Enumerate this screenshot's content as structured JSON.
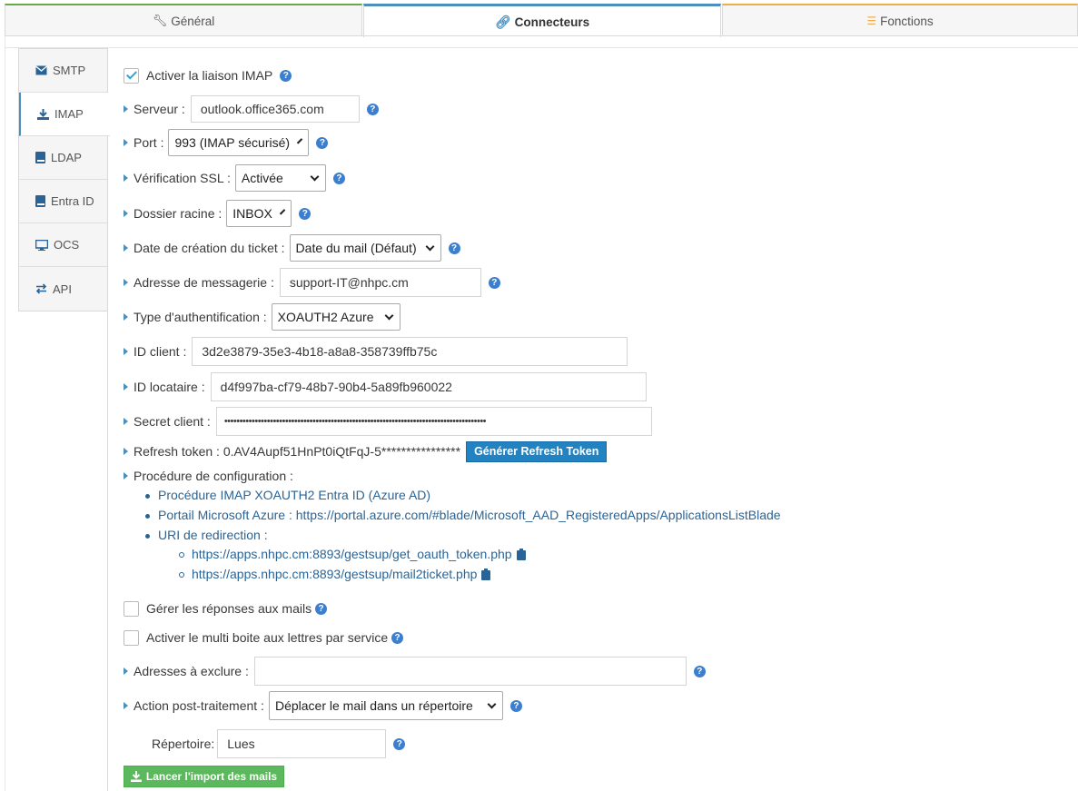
{
  "top_tabs": [
    {
      "label": "Général",
      "icon": "wrench-icon"
    },
    {
      "label": "Connecteurs",
      "icon": "link-icon"
    },
    {
      "label": "Fonctions",
      "icon": "list-icon"
    }
  ],
  "side_tabs": [
    {
      "label": "SMTP",
      "icon": "envelope-icon"
    },
    {
      "label": "IMAP",
      "icon": "download-icon"
    },
    {
      "label": "LDAP",
      "icon": "book-icon"
    },
    {
      "label": "Entra ID",
      "icon": "book-icon"
    },
    {
      "label": "OCS",
      "icon": "monitor-icon"
    },
    {
      "label": "API",
      "icon": "exchange-icon"
    }
  ],
  "form": {
    "enable_imap_label": "Activer la liaison IMAP",
    "server_label": "Serveur :",
    "server_value": "outlook.office365.com",
    "port_label": "Port :",
    "port_value": "993 (IMAP sécurisé)",
    "ssl_label": "Vérification SSL :",
    "ssl_value": "Activée",
    "root_label": "Dossier racine :",
    "root_value": "INBOX",
    "date_label": "Date de création du ticket :",
    "date_value": "Date du mail (Défaut)",
    "email_label": "Adresse de messagerie :",
    "email_value": "support-IT@nhpc.cm",
    "auth_label": "Type d'authentification :",
    "auth_value": "XOAUTH2 Azure",
    "client_id_label": "ID client :",
    "client_id_value": "3d2e3879-35e3-4b18-a8a8-358739ffb75c",
    "tenant_id_label": "ID locataire :",
    "tenant_id_value": "d4f997ba-cf79-48b7-90b4-5a89fb960022",
    "secret_label": "Secret client :",
    "secret_value": "••••••••••••••••••••••••••••••••••••••••••••••••••••••••••••••••••••••••••••••••••••••",
    "refresh_label": "Refresh token : 0.AV4Aupf51HnPt0iQtFqJ-5****************",
    "refresh_button": "Générer Refresh Token",
    "procedure_label": "Procédure de configuration :",
    "procedure_link": "Procédure IMAP XOAUTH2 Entra ID (Azure AD)",
    "portal_text": "Portail Microsoft Azure : https://portal.azure.com/#blade/Microsoft_AAD_RegisteredApps/ApplicationsListBlade",
    "uri_label": "URI de redirection :",
    "uri_1": "https://apps.nhpc.cm:8893/gestsup/get_oauth_token.php",
    "uri_2": "https://apps.nhpc.cm:8893/gestsup/mail2ticket.php",
    "replies_label": "Gérer les réponses aux mails",
    "multi_label": "Activer le multi boite aux lettres par service",
    "exclude_label": "Adresses à exclure :",
    "exclude_value": "",
    "post_label": "Action post-traitement :",
    "post_value": "Déplacer le mail dans un répertoire",
    "dir_label": "Répertoire:",
    "dir_value": "Lues",
    "import_button": "Lancer l'import des mails"
  },
  "colors": {
    "accent": "#4c8fbd",
    "help": "#3d7fcf",
    "link": "#2a6496",
    "green": "#5cb85c",
    "blue_btn": "#2283c3"
  }
}
